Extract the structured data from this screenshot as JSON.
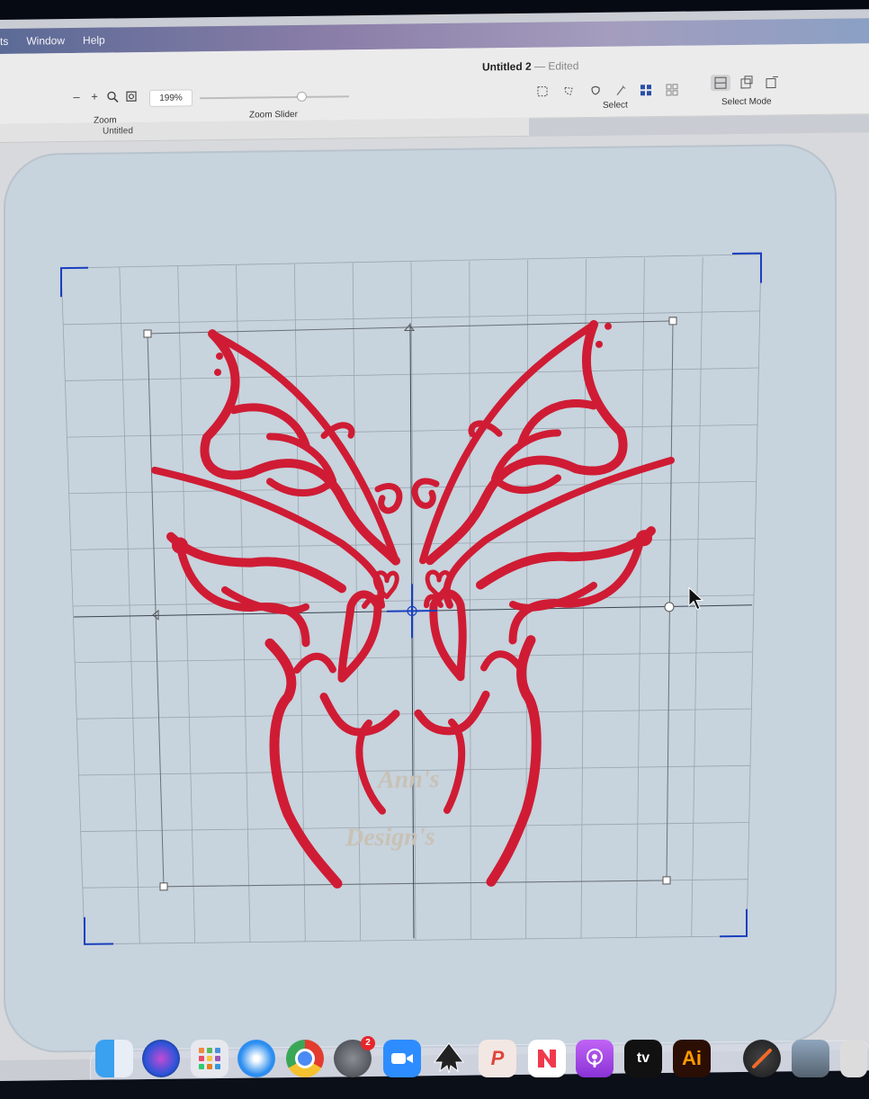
{
  "menubar": {
    "items": [
      "ts",
      "Window",
      "Help"
    ]
  },
  "document": {
    "title": "Untitled 2",
    "separator": "—",
    "status": "Edited",
    "tab_label": "Untitled"
  },
  "toolbar": {
    "zoom_out_symbol": "–",
    "zoom_in_symbol": "+",
    "zoom_label": "Zoom",
    "zoom_value": "199%",
    "zoom_slider_label": "Zoom Slider",
    "zoom_slider_level": 0.68,
    "select_label": "Select",
    "select_mode_label": "Select Mode"
  },
  "canvas": {
    "design_color": "#cf1c34",
    "watermark_line1": "Ann's",
    "watermark_line2": "Design's",
    "grid_color": "#9aa5ae",
    "hoop_color": "#c7d3dd",
    "selection_color": "#1a3fbf"
  },
  "dock": {
    "apps": [
      {
        "icon": "finder-icon",
        "label": ""
      },
      {
        "icon": "siri-icon",
        "label": ""
      },
      {
        "icon": "launchpad-icon",
        "label": ""
      },
      {
        "icon": "safari-icon",
        "label": ""
      },
      {
        "icon": "chrome-icon",
        "label": ""
      },
      {
        "icon": "system-settings-icon",
        "label": "",
        "badge": "2"
      },
      {
        "icon": "zoom-icon",
        "label": ""
      },
      {
        "icon": "inkscape-icon",
        "label": ""
      },
      {
        "icon": "pen-app-icon",
        "label": ""
      },
      {
        "icon": "news-icon",
        "label": ""
      },
      {
        "icon": "podcasts-icon",
        "label": ""
      },
      {
        "icon": "apple-tv-icon",
        "label": "tv"
      },
      {
        "icon": "illustrator-icon",
        "label": "Ai"
      },
      {
        "icon": "embroidery-app-icon",
        "label": ""
      },
      {
        "icon": "preview-icon",
        "label": ""
      }
    ]
  }
}
